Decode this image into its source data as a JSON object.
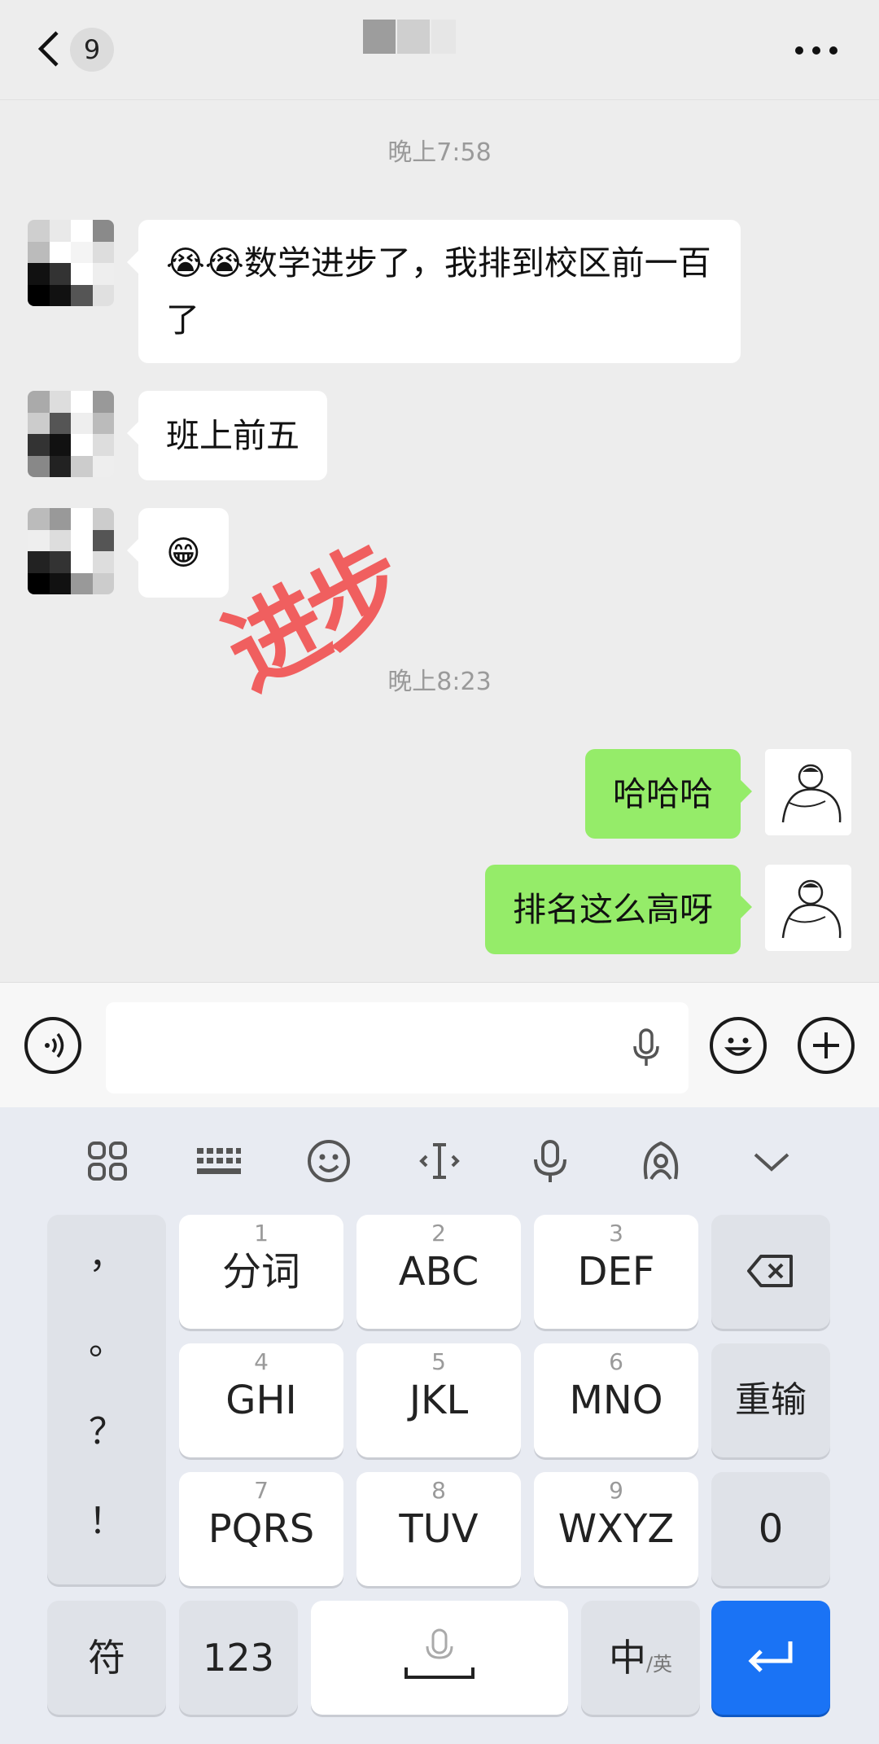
{
  "header": {
    "unread_count": "9",
    "title_redacted": true,
    "icons": [
      "back-icon",
      "more-icon"
    ]
  },
  "chat": {
    "timestamps": [
      "晚上7:58",
      "晚上8:23"
    ],
    "incoming": [
      {
        "text": "😭😭数学进步了，我排到校区前一百了"
      },
      {
        "text": "班上前五"
      },
      {
        "text": "😁"
      }
    ],
    "outgoing": [
      {
        "text": "哈哈哈"
      },
      {
        "text": "排名这么高呀"
      }
    ],
    "overlay_stamp": "进步"
  },
  "input_bar": {
    "placeholder": "",
    "icons": [
      "voice-icon",
      "mic-icon",
      "emoji-icon",
      "plus-icon"
    ]
  },
  "keyboard": {
    "toolbar_icons": [
      "grid-icon",
      "keyboard-icon",
      "smiley-icon",
      "cursor-icon",
      "mic-icon",
      "swipe-icon",
      "collapse-icon"
    ],
    "punctuation": [
      "，",
      "。",
      "？",
      "！"
    ],
    "keys": [
      {
        "num": "1",
        "label": "分词"
      },
      {
        "num": "2",
        "label": "ABC"
      },
      {
        "num": "3",
        "label": "DEF"
      },
      {
        "num": "4",
        "label": "GHI"
      },
      {
        "num": "5",
        "label": "JKL"
      },
      {
        "num": "6",
        "label": "MNO"
      },
      {
        "num": "7",
        "label": "PQRS"
      },
      {
        "num": "8",
        "label": "TUV"
      },
      {
        "num": "9",
        "label": "WXYZ"
      }
    ],
    "reinput": "重输",
    "zero": "0",
    "symbol": "符",
    "numbers": "123",
    "lang_main": "中",
    "lang_sub": "/英",
    "accent": "#1a73f5"
  }
}
